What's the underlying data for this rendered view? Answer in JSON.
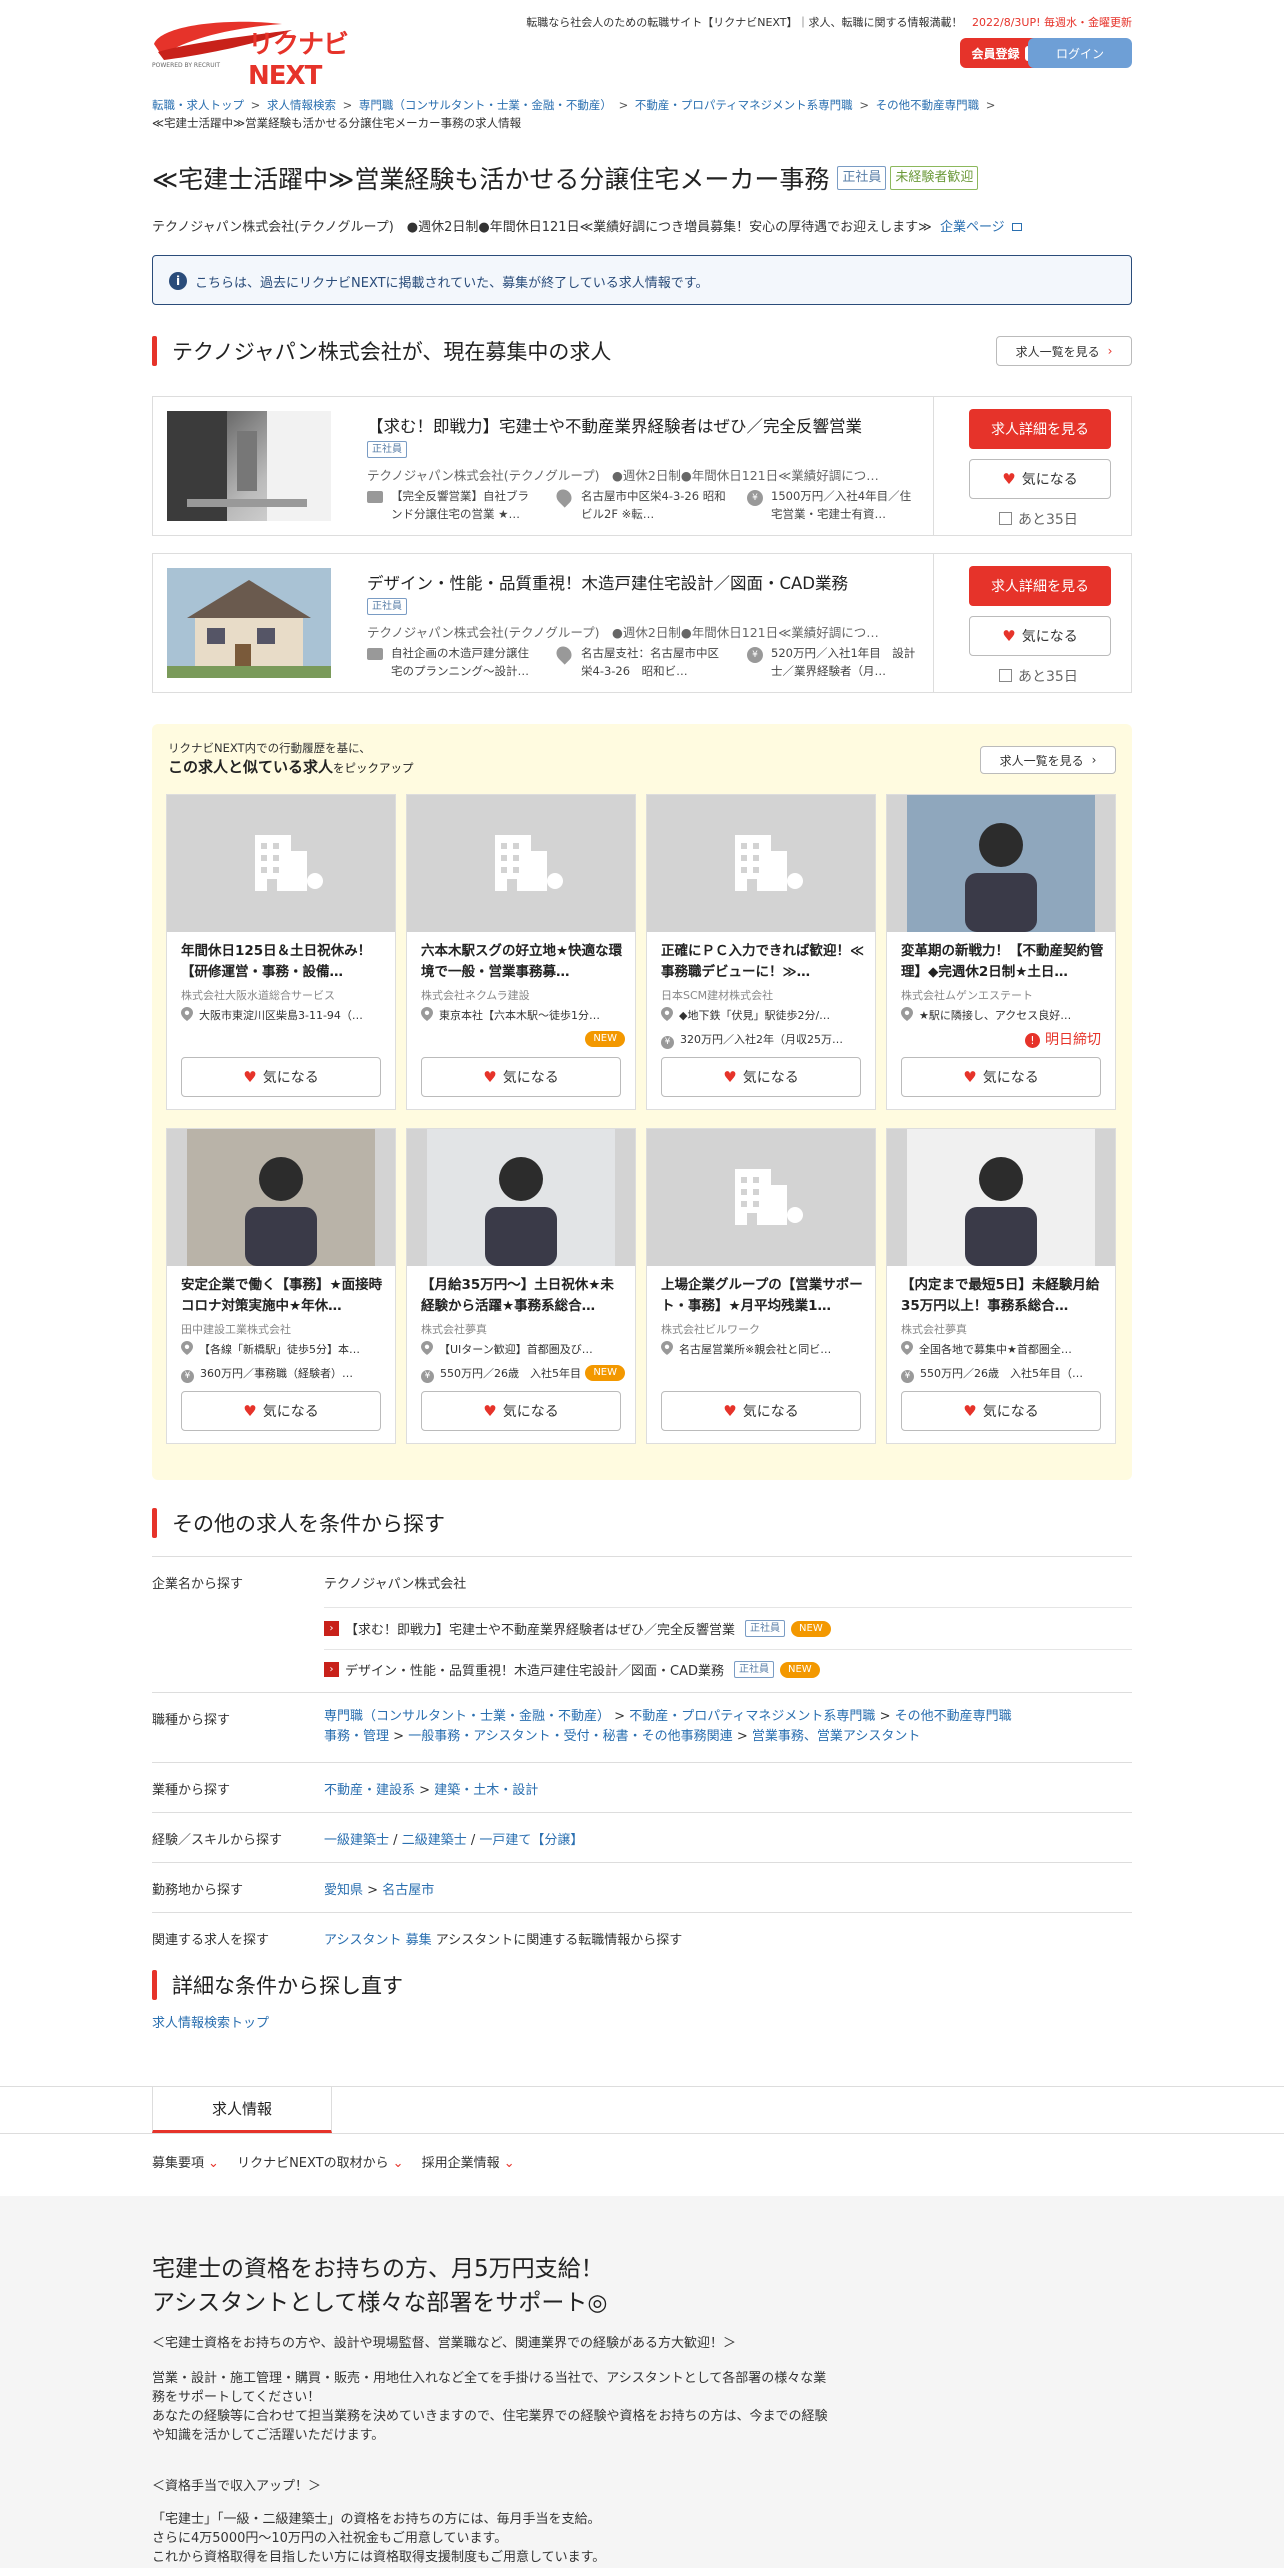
{
  "header": {
    "logo_text": "リクナビNEXT",
    "logo_sub": "POWERED BY RECRUIT",
    "tagline": "転職なら社会人のための転職サイト【リクナビNEXT】｜求人、転職に関する情報満載！",
    "update_note": "2022/8/3UP! 毎週水・金曜更新",
    "register_label": "会員登録",
    "register_badge": "無料",
    "login_label": "ログイン"
  },
  "breadcrumb": {
    "items": [
      "転職・求人トップ",
      "求人情報検索",
      "専門職（コンサルタント・士業・金融・不動産）",
      "不動産・プロパティマネジメント系専門職",
      "その他不動産専門職"
    ],
    "sep": ">",
    "current": "≪宅建士活躍中≫営業経験も活かせる分譲住宅メーカー事務の求人情報"
  },
  "job": {
    "title": "≪宅建士活躍中≫営業経験も活かせる分譲住宅メーカー事務",
    "tag_employment": "正社員",
    "tag_experience": "未経験者歓迎",
    "company_line": "テクノジャパン株式会社(テクノグループ)　●週休2日制●年間休日121日≪業績好調につき増員募集！安心の厚待遇でお迎えします≫",
    "company_page_link": "企業ページ"
  },
  "notice": {
    "text": "こちらは、過去にリクナビNEXTに掲載されていた、募集が終了している求人情報です。"
  },
  "current_jobs": {
    "heading": "テクノジャパン株式会社が、現在募集中の求人",
    "list_link": "求人一覧を見る",
    "items": [
      {
        "title": "【求む！即戦力】宅建士や不動産業界経験者はぜひ／完全反響営業",
        "tag": "正社員",
        "company": "テクノジャパン株式会社(テクノグループ)　●週休2日制●年間休日121日≪業績好調につ…",
        "work1": "【完全反響営業】自社ブラ",
        "work2": "ンド分譲住宅の営業 ★…",
        "loc1": "名古屋市中区栄4-3-26 昭和",
        "loc2": "ビル2F ※転…",
        "sal1": "1500万円／入社4年目／住",
        "sal2": "宅営業・宅建士有資…",
        "detail_btn": "求人詳細を見る",
        "fav_btn": "気になる",
        "remain": "あと35日"
      },
      {
        "title": "デザイン・性能・品質重視！木造戸建住宅設計／図面・CAD業務",
        "tag": "正社員",
        "company": "テクノジャパン株式会社(テクノグループ)　●週休2日制●年間休日121日≪業績好調につ…",
        "work1": "自社企画の木造戸建分譲住",
        "work2": "宅のプランニング～設計…",
        "loc1": "名古屋支社：名古屋市中区",
        "loc2": "栄4-3-26　昭和ビ…",
        "sal1": "520万円／入社1年目　設計",
        "sal2": "士／業界経験者（月…",
        "detail_btn": "求人詳細を見る",
        "fav_btn": "気になる",
        "remain": "あと35日"
      }
    ]
  },
  "similar": {
    "intro": "リクナビNEXT内での行動履歴を基に、",
    "heading_bold": "この求人と似ている求人",
    "heading_rest": "をピックアップ",
    "list_link": "求人一覧を見る",
    "fav_label": "気になる",
    "items": [
      {
        "title": "年間休日125日＆土日祝休み！【研修運営・事務・設備…",
        "company": "株式会社大阪水道総合サービス",
        "loc": "大阪市東淀川区柴島3-11-94（…",
        "salary": "",
        "new": "",
        "deadline": ""
      },
      {
        "title": "六本木駅スグの好立地★快適な環境で一般・営業事務募…",
        "company": "株式会社ネクムラ建設",
        "loc": "東京本社【六本木駅～徒歩1分…",
        "salary": "",
        "new": "NEW",
        "deadline": ""
      },
      {
        "title": "正確にＰＣ入力できれば歓迎！≪事務職デビューに！≫…",
        "company": "日本SCM建材株式会社",
        "loc": "◆地下鉄「伏見」駅徒歩2分/…",
        "salary": "320万円／入社2年（月収25万…",
        "new": "",
        "deadline": ""
      },
      {
        "title": "変革期の新戦力！【不動産契約管理】◆完週休2日制★土日…",
        "company": "株式会社ムゲンエステート",
        "loc": "★駅に隣接し、アクセス良好…",
        "salary": "",
        "new": "",
        "deadline": "明日締切"
      },
      {
        "title": "安定企業で働く【事務】★面接時コロナ対策実施中★年休…",
        "company": "田中建設工業株式会社",
        "loc": "【各線「新橋駅」徒歩5分】本…",
        "salary": "360万円／事務職（経験者）…",
        "new": "",
        "deadline": ""
      },
      {
        "title": "【月給35万円～】土日祝休★未経験から活躍★事務系総合…",
        "company": "株式会社夢真",
        "loc": "【UIターン歓迎】首都圏及び…",
        "salary": "550万円／26歳　入社5年目（…",
        "new": "NEW",
        "deadline": ""
      },
      {
        "title": "上場企業グループの【営業サポート・事務】★月平均残業1…",
        "company": "株式会社ビルワーク",
        "loc": "名古屋営業所※親会社と同ビ…",
        "salary": "",
        "new": "",
        "deadline": ""
      },
      {
        "title": "【内定まで最短5日】未経験月給35万円以上！事務系総合…",
        "company": "株式会社夢真",
        "loc": "全国各地で募集中★首都圏全…",
        "salary": "550万円／26歳　入社5年目（…",
        "new": "",
        "deadline": ""
      }
    ]
  },
  "other_search": {
    "heading": "その他の求人を条件から探す",
    "company_label": "企業名から探す",
    "company_link": "テクノジャパン株式会社",
    "company_jobs": [
      {
        "title": "【求む！即戦力】宅建士や不動産業界経験者はぜひ／完全反響営業",
        "tag": "正社員",
        "new": "NEW"
      },
      {
        "title": "デザイン・性能・品質重視！木造戸建住宅設計／図面・CAD業務",
        "tag": "正社員",
        "new": "NEW"
      }
    ],
    "occupation_label": "職種から探す",
    "occ1": "専門職（コンサルタント・士業・金融・不動産）",
    "occ2": "不動産・プロパティマネジメント系専門職",
    "occ3": "その他不動産専門職",
    "occ4": "事務・管理",
    "occ5": "一般事務・アシスタント・受付・秘書・その他事務関連",
    "occ6": "営業事務、営業アシスタント",
    "industry_label": "業種から探す",
    "ind1": "不動産・建設系",
    "ind2": "建築・土木・設計",
    "skill_label": "経験／スキルから探す",
    "skill1": "一級建築士",
    "skill2": "二級建築士",
    "skill3": "一戸建て【分譲】",
    "area_label": "勤務地から探す",
    "area1": "愛知県",
    "area2": "名古屋市",
    "related_label": "関連する求人を探す",
    "related_link": "アシスタント 募集",
    "related_text": "アシスタントに関連する転職情報から探す",
    "gt": ">",
    "slash": "/"
  },
  "detail_search": {
    "heading": "詳細な条件から探し直す",
    "link": "求人情報検索トップ"
  },
  "tabs": {
    "active": "求人情報",
    "sub": [
      "募集要項",
      "リクナビNEXTの取材から",
      "採用企業情報"
    ]
  },
  "content": {
    "headline1": "宅建士の資格をお持ちの方、月5万円支給！",
    "headline2": "アシスタントとして様々な部署をサポート◎",
    "sub": "＜宅建士資格をお持ちの方や、設計や現場監督、営業職など、関連業界での経験がある方大歓迎！＞",
    "p1": "営業・設計・施工管理・購買・販売・用地仕入れなど全てを手掛ける当社で、アシスタントとして各部署の様々な業",
    "p2": "務をサポートしてください！",
    "p3": "あなたの経験等に合わせて担当業務を決めていきますので、住宅業界での経験や資格をお持ちの方は、今までの経験",
    "p4": "や知識を活かしてご活躍いただけます。",
    "sec": "＜資格手当で収入アップ！＞",
    "q1": "「宅建士」「一級・二級建築士」の資格をお持ちの方には、毎月手当を支給。",
    "q2": "さらに4万5000円～10万円の入社祝金もご用意しています。",
    "q3": "これから資格取得を目指したい方には資格取得支援制度もご用意しています。"
  },
  "colors": {
    "accent": "#e6332a",
    "link": "#2a6fb0",
    "similar_bg": "#fffbe0",
    "login": "#6e9fd6"
  }
}
